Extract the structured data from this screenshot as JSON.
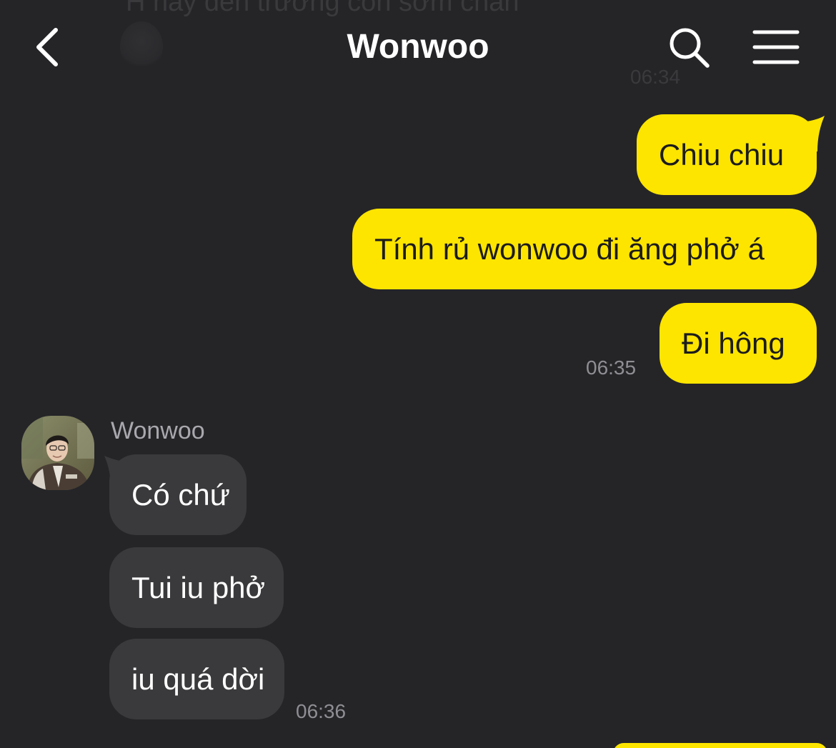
{
  "header": {
    "title": "Wonwoo"
  },
  "faded_message": {
    "text": "H nay đến trường con sớm chán",
    "time": "06:34"
  },
  "my_messages": [
    {
      "text": "Chiu chiu"
    },
    {
      "text": "Tính rủ wonwoo đi ăng phở á"
    },
    {
      "text": "Đi hông"
    }
  ],
  "my_time": "06:35",
  "contact": {
    "name": "Wonwoo"
  },
  "their_messages": [
    {
      "text": "Có chứ"
    },
    {
      "text": "Tui iu phở"
    },
    {
      "text": "iu quá dời"
    }
  ],
  "their_time": "06:36",
  "colors": {
    "background": "#252528",
    "my_bubble": "#fee500",
    "their_bubble": "#3a3a3c",
    "timestamp": "#8e8e93"
  },
  "icons": {
    "back": "chevron-left-icon",
    "search": "search-icon",
    "menu": "hamburger-menu-icon"
  }
}
